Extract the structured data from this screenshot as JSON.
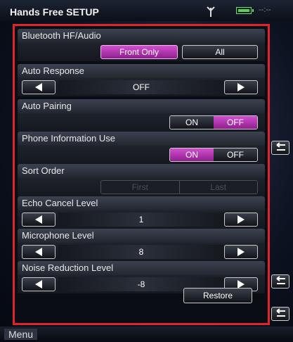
{
  "header": {
    "title": "Hands Free SETUP",
    "clock": "--:--"
  },
  "sections": {
    "bluetooth_hf_audio": {
      "label": "Bluetooth HF/Audio",
      "option1": "Front Only",
      "option2": "All",
      "selected": "Front Only"
    },
    "auto_response": {
      "label": "Auto Response",
      "value": "OFF"
    },
    "auto_pairing": {
      "label": "Auto Pairing",
      "on": "ON",
      "off": "OFF",
      "selected": "OFF"
    },
    "phone_information_use": {
      "label": "Phone Information Use",
      "on": "ON",
      "off": "OFF",
      "selected": "ON"
    },
    "sort_order": {
      "label": "Sort Order",
      "first": "First",
      "last": "Last"
    },
    "echo_cancel_level": {
      "label": "Echo Cancel Level",
      "value": "1"
    },
    "microphone_level": {
      "label": "Microphone Level",
      "value": "8"
    },
    "noise_reduction_level": {
      "label": "Noise Reduction Level",
      "value": "-8"
    }
  },
  "footer": {
    "restore_label": "Restore",
    "menu_label": "Menu"
  },
  "colors": {
    "highlight": "#c03bc0",
    "border": "#e0242d"
  }
}
